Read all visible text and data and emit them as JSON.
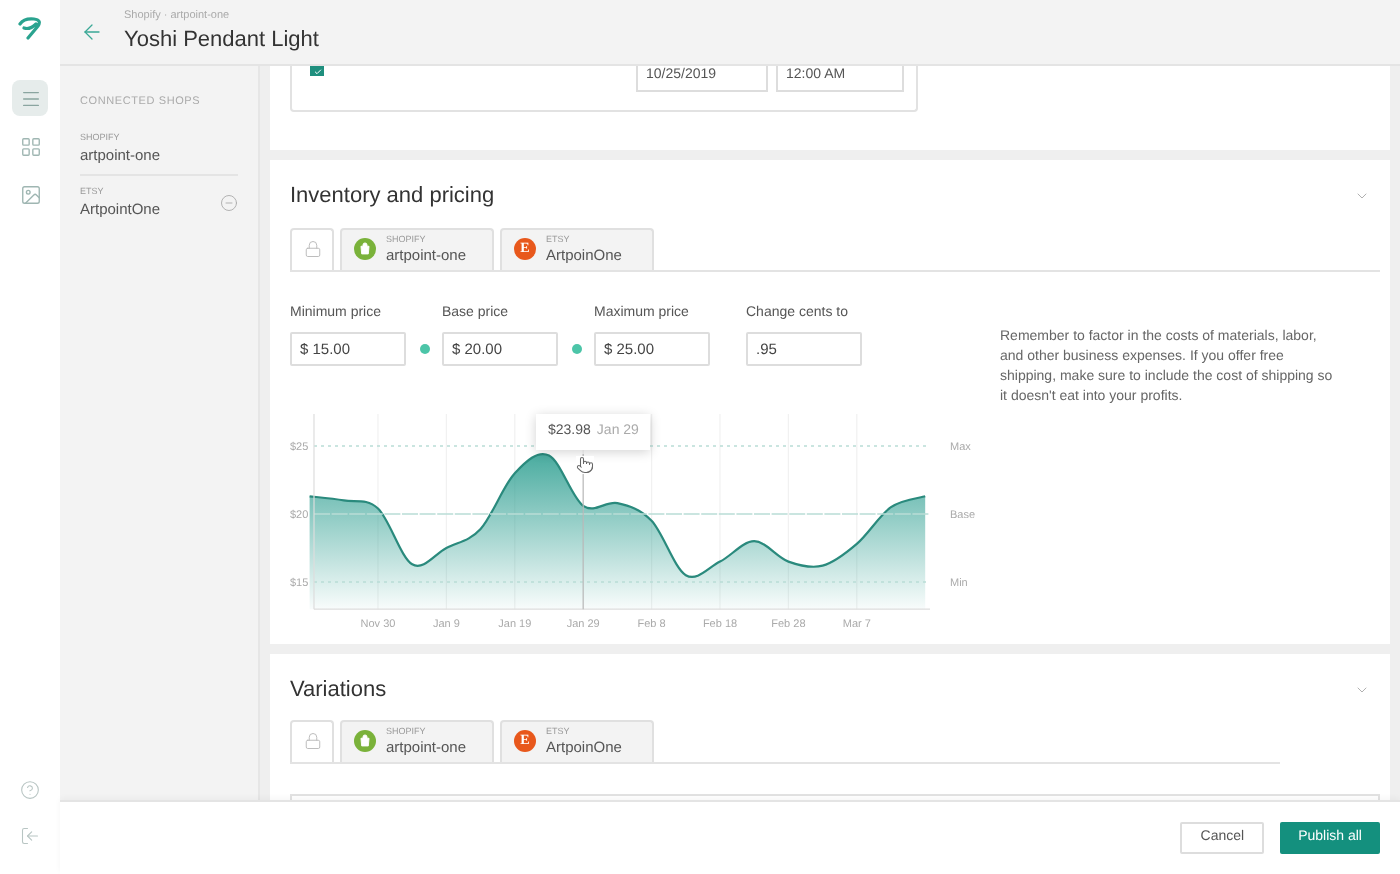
{
  "nav_rail": {
    "items": [
      {
        "kind": "list",
        "selected": true
      },
      {
        "kind": "grid",
        "selected": false
      },
      {
        "kind": "image",
        "selected": false
      }
    ]
  },
  "header": {
    "breadcrumb": "Shopify · artpoint-one",
    "title": "Yoshi Pendant Light"
  },
  "sidebar": {
    "heading": "CONNECTED SHOPS",
    "shops": [
      {
        "platform": "SHOPIFY",
        "name": "artpoint-one",
        "removable": false
      },
      {
        "platform": "ETSY",
        "name": "ArtpointOne",
        "removable": true
      }
    ]
  },
  "schedule_card": {
    "checked": true,
    "date": "10/25/2019",
    "time": "12:00 AM"
  },
  "inventory": {
    "title": "Inventory and pricing",
    "expanded": true,
    "tabs": [
      {
        "kind": "lock",
        "selected": true
      },
      {
        "kind": "shopify",
        "platform": "SHOPIFY",
        "name": "artpoint-one",
        "color": "#7ab23a",
        "selected": false
      },
      {
        "kind": "etsy",
        "platform": "ETSY",
        "name": "ArtpoinOne",
        "badge": "E",
        "color": "#e8581c",
        "selected": false
      }
    ],
    "fields": [
      {
        "label": "Minimum price",
        "value": "$ 15.00",
        "linked": true
      },
      {
        "label": "Base price",
        "value": "$ 20.00",
        "linked": true
      },
      {
        "label": "Maximum price",
        "value": "$ 25.00",
        "linked": false
      },
      {
        "label": "Change cents to",
        "value": ".95",
        "linked": false
      }
    ],
    "price_chart": {
      "chart_data": {
        "type": "area",
        "categories": [
          null,
          null,
          "Nov 30",
          null,
          "Jan 9",
          null,
          "Jan 19",
          null,
          "Jan 29",
          null,
          "Feb 8",
          null,
          "Feb 18",
          null,
          "Feb 28",
          null,
          "Mar 7",
          null,
          null
        ],
        "series": [
          {
            "color": "#2a9d8f",
            "values": [
              21.3,
              21.0,
              20.4,
              16.3,
              17.5,
              18.9,
              23.0,
              24.3,
              20.6,
              20.8,
              19.5,
              15.5,
              16.5,
              18.0,
              16.5,
              16.2,
              17.8,
              20.5,
              21.3
            ]
          }
        ],
        "ylim": [
          13,
          27
        ],
        "grid": true,
        "yticks": [
          {
            "value": 15,
            "label": "$15"
          },
          {
            "value": 20,
            "label": "$20"
          },
          {
            "value": 25,
            "label": "$25"
          }
        ]
      },
      "guides": [
        {
          "label": "Max"
        },
        {
          "label": "Base"
        },
        {
          "label": "Min"
        }
      ],
      "tooltip": {
        "price": "$23.98",
        "date": "Jan 29"
      }
    },
    "help_text": "Remember to factor in the costs of materials, labor, and other business expenses. If you offer free shipping, make sure to include the cost of shipping so it doesn't eat into your profits."
  },
  "variations": {
    "title": "Variations",
    "expanded": true,
    "tabs": [
      {
        "kind": "lock",
        "selected": true
      },
      {
        "kind": "shopify",
        "platform": "SHOPIFY",
        "name": "artpoint-one",
        "color": "#7ab23a",
        "selected": false
      },
      {
        "kind": "etsy",
        "platform": "ETSY",
        "name": "ArtpoinOne",
        "badge": "E",
        "color": "#e8581c",
        "selected": false
      }
    ]
  },
  "footer": {
    "buttons": [
      {
        "label": "Cancel",
        "kind": "secondary"
      },
      {
        "label": "Publish all",
        "kind": "primary"
      }
    ]
  }
}
